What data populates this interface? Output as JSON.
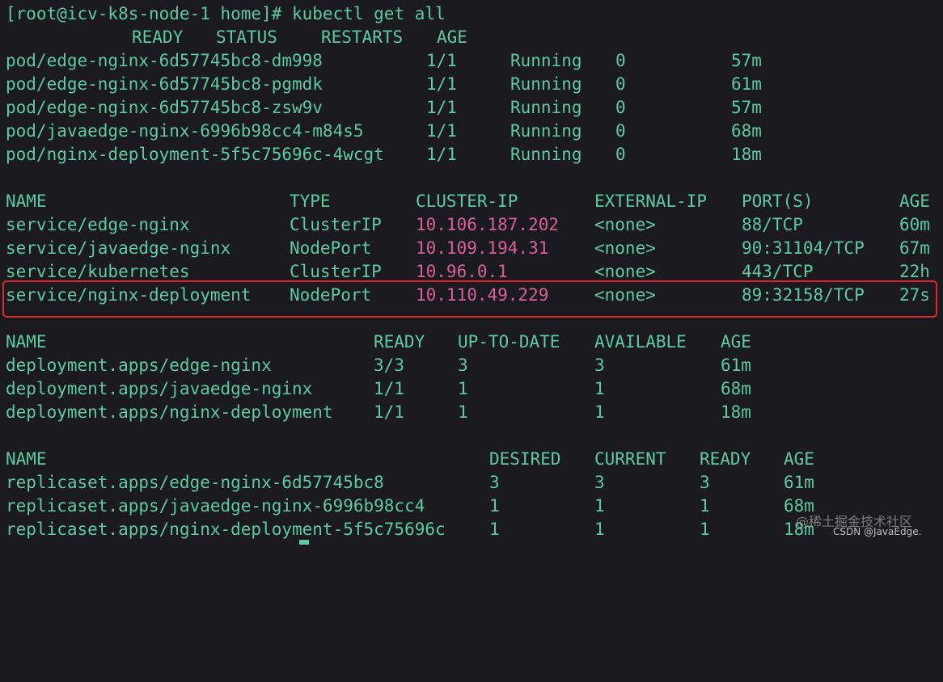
{
  "prompt": "[root@icv-k8s-node-1 home]# kubectl get all",
  "pods": {
    "headers": [
      "READY",
      "STATUS",
      "RESTARTS",
      "AGE"
    ],
    "rows": [
      [
        "pod/edge-nginx-6d57745bc8-dm998",
        "1/1",
        "Running",
        "0",
        "57m"
      ],
      [
        "pod/edge-nginx-6d57745bc8-pgmdk",
        "1/1",
        "Running",
        "0",
        "61m"
      ],
      [
        "pod/edge-nginx-6d57745bc8-zsw9v",
        "1/1",
        "Running",
        "0",
        "57m"
      ],
      [
        "pod/javaedge-nginx-6996b98cc4-m84s5",
        "1/1",
        "Running",
        "0",
        "68m"
      ],
      [
        "pod/nginx-deployment-5f5c75696c-4wcgt",
        "1/1",
        "Running",
        "0",
        "18m"
      ]
    ]
  },
  "services": {
    "headers": [
      "NAME",
      "TYPE",
      "CLUSTER-IP",
      "EXTERNAL-IP",
      "PORT(S)",
      "AGE"
    ],
    "rows": [
      [
        "service/edge-nginx",
        "ClusterIP",
        "10.106.187.202",
        "<none>",
        "88/TCP",
        "60m"
      ],
      [
        "service/javaedge-nginx",
        "NodePort",
        "10.109.194.31",
        "<none>",
        "90:31104/TCP",
        "67m"
      ],
      [
        "service/kubernetes",
        "ClusterIP",
        "10.96.0.1",
        "<none>",
        "443/TCP",
        "22h"
      ],
      [
        "service/nginx-deployment",
        "NodePort",
        "10.110.49.229",
        "<none>",
        "89:32158/TCP",
        "27s"
      ]
    ]
  },
  "deployments": {
    "headers": [
      "NAME",
      "READY",
      "UP-TO-DATE",
      "AVAILABLE",
      "AGE"
    ],
    "rows": [
      [
        "deployment.apps/edge-nginx",
        "3/3",
        "3",
        "3",
        "61m"
      ],
      [
        "deployment.apps/javaedge-nginx",
        "1/1",
        "1",
        "1",
        "68m"
      ],
      [
        "deployment.apps/nginx-deployment",
        "1/1",
        "1",
        "1",
        "18m"
      ]
    ]
  },
  "replicasets": {
    "headers": [
      "NAME",
      "DESIRED",
      "CURRENT",
      "READY",
      "AGE"
    ],
    "rows": [
      [
        "replicaset.apps/edge-nginx-6d57745bc8",
        "3",
        "3",
        "3",
        "61m"
      ],
      [
        "replicaset.apps/javaedge-nginx-6996b98cc4",
        "1",
        "1",
        "1",
        "68m"
      ],
      [
        "replicaset.apps/nginx-deployment-5f5c75696c",
        "1",
        "1",
        "1",
        "18m"
      ]
    ]
  },
  "watermark": {
    "line1": "@稀土掘金技术社区",
    "line2": "CSDN @JavaEdge."
  },
  "colors": {
    "background": "#1b1b1f",
    "text": "#5fc9a0",
    "ip": "#d8609a",
    "highlight": "#e0262d"
  }
}
